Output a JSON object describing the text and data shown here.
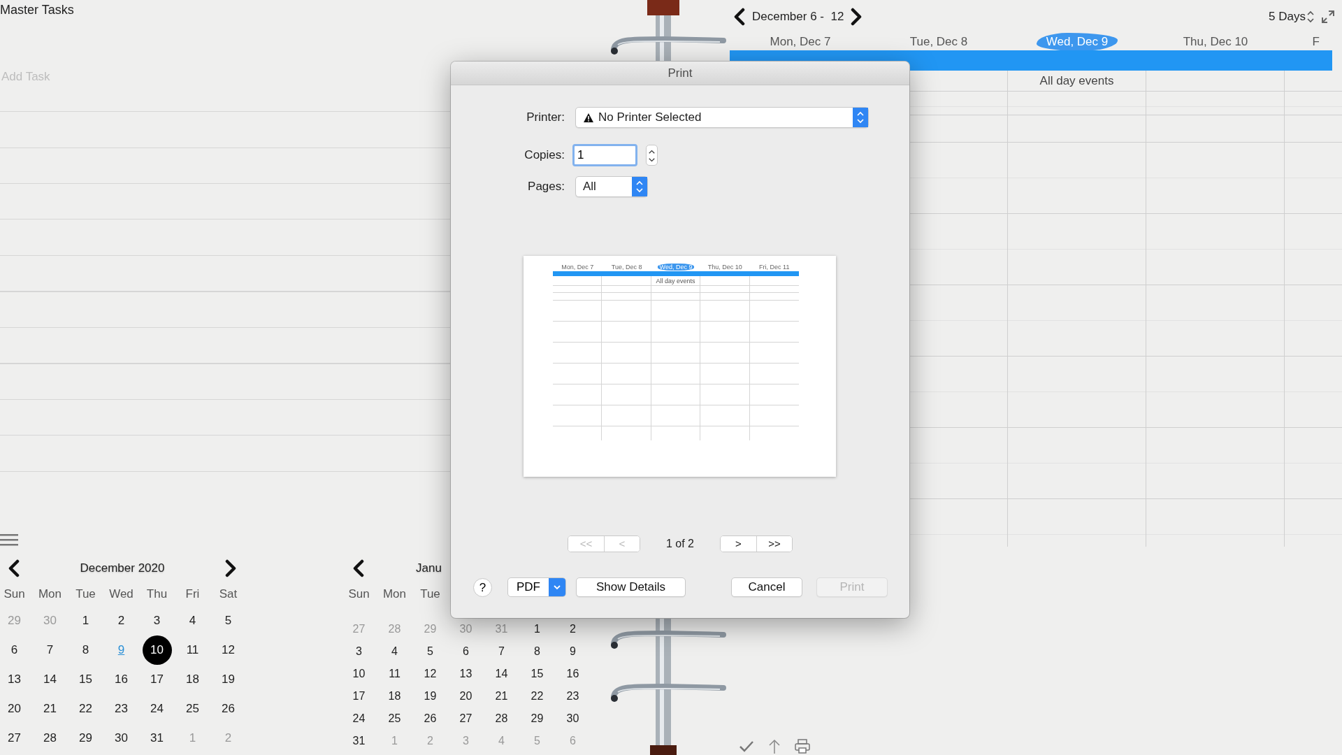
{
  "tasks_page": {
    "title": "Master Tasks",
    "add_task": {
      "placeholder": "Add Task"
    }
  },
  "mini_calendars": [
    {
      "title": "December 2020",
      "next_arrow": true,
      "weekdays": [
        "Sun",
        "Mon",
        "Tue",
        "Wed",
        "Thu",
        "Fri",
        "Sat"
      ],
      "days": [
        {
          "label": "29",
          "outside": true,
          "selected": false,
          "highlighted": false
        },
        {
          "label": "30",
          "outside": true,
          "selected": false,
          "highlighted": false
        },
        {
          "label": "1",
          "outside": false,
          "selected": false,
          "highlighted": false
        },
        {
          "label": "2",
          "outside": false,
          "selected": false,
          "highlighted": false
        },
        {
          "label": "3",
          "outside": false,
          "selected": false,
          "highlighted": false
        },
        {
          "label": "4",
          "outside": false,
          "selected": false,
          "highlighted": false
        },
        {
          "label": "5",
          "outside": false,
          "selected": false,
          "highlighted": false
        },
        {
          "label": "6",
          "outside": false,
          "selected": false,
          "highlighted": false
        },
        {
          "label": "7",
          "outside": false,
          "selected": false,
          "highlighted": false
        },
        {
          "label": "8",
          "outside": false,
          "selected": false,
          "highlighted": false
        },
        {
          "label": "9",
          "outside": false,
          "selected": false,
          "highlighted": true
        },
        {
          "label": "10",
          "outside": false,
          "selected": true,
          "highlighted": false
        },
        {
          "label": "11",
          "outside": false,
          "selected": false,
          "highlighted": false
        },
        {
          "label": "12",
          "outside": false,
          "selected": false,
          "highlighted": false
        },
        {
          "label": "13",
          "outside": false,
          "selected": false,
          "highlighted": false
        },
        {
          "label": "14",
          "outside": false,
          "selected": false,
          "highlighted": false
        },
        {
          "label": "15",
          "outside": false,
          "selected": false,
          "highlighted": false
        },
        {
          "label": "16",
          "outside": false,
          "selected": false,
          "highlighted": false
        },
        {
          "label": "17",
          "outside": false,
          "selected": false,
          "highlighted": false
        },
        {
          "label": "18",
          "outside": false,
          "selected": false,
          "highlighted": false
        },
        {
          "label": "19",
          "outside": false,
          "selected": false,
          "highlighted": false
        },
        {
          "label": "20",
          "outside": false,
          "selected": false,
          "highlighted": false
        },
        {
          "label": "21",
          "outside": false,
          "selected": false,
          "highlighted": false
        },
        {
          "label": "22",
          "outside": false,
          "selected": false,
          "highlighted": false
        },
        {
          "label": "23",
          "outside": false,
          "selected": false,
          "highlighted": false
        },
        {
          "label": "24",
          "outside": false,
          "selected": false,
          "highlighted": false
        },
        {
          "label": "25",
          "outside": false,
          "selected": false,
          "highlighted": false
        },
        {
          "label": "26",
          "outside": false,
          "selected": false,
          "highlighted": false
        },
        {
          "label": "27",
          "outside": false,
          "selected": false,
          "highlighted": false
        },
        {
          "label": "28",
          "outside": false,
          "selected": false,
          "highlighted": false
        },
        {
          "label": "29",
          "outside": false,
          "selected": false,
          "highlighted": false
        },
        {
          "label": "30",
          "outside": false,
          "selected": false,
          "highlighted": false
        },
        {
          "label": "31",
          "outside": false,
          "selected": false,
          "highlighted": false
        },
        {
          "label": "1",
          "outside": true,
          "selected": false,
          "highlighted": false
        },
        {
          "label": "2",
          "outside": true,
          "selected": false,
          "highlighted": false
        }
      ]
    },
    {
      "title": "Janu",
      "next_arrow": false,
      "weekdays": [
        "Sun",
        "Mon",
        "Tue"
      ],
      "days": [
        {
          "label": "27",
          "outside": true,
          "selected": false
        },
        {
          "label": "28",
          "outside": true,
          "selected": false
        },
        {
          "label": "29",
          "outside": true,
          "selected": false
        },
        {
          "label": "30",
          "outside": true,
          "selected": false
        },
        {
          "label": "31",
          "outside": true,
          "selected": false
        },
        {
          "label": "1",
          "outside": false,
          "selected": false
        },
        {
          "label": "2",
          "outside": false,
          "selected": false
        },
        {
          "label": "3",
          "outside": false,
          "selected": false
        },
        {
          "label": "4",
          "outside": false,
          "selected": false
        },
        {
          "label": "5",
          "outside": false,
          "selected": false
        },
        {
          "label": "6",
          "outside": false,
          "selected": false
        },
        {
          "label": "7",
          "outside": false,
          "selected": false
        },
        {
          "label": "8",
          "outside": false,
          "selected": false
        },
        {
          "label": "9",
          "outside": false,
          "selected": false
        },
        {
          "label": "10",
          "outside": false,
          "selected": false
        },
        {
          "label": "11",
          "outside": false,
          "selected": false
        },
        {
          "label": "12",
          "outside": false,
          "selected": false
        },
        {
          "label": "13",
          "outside": false,
          "selected": false
        },
        {
          "label": "14",
          "outside": false,
          "selected": false
        },
        {
          "label": "15",
          "outside": false,
          "selected": false
        },
        {
          "label": "16",
          "outside": false,
          "selected": false
        },
        {
          "label": "17",
          "outside": false,
          "selected": false
        },
        {
          "label": "18",
          "outside": false,
          "selected": false
        },
        {
          "label": "19",
          "outside": false,
          "selected": false
        },
        {
          "label": "20",
          "outside": false,
          "selected": false
        },
        {
          "label": "21",
          "outside": false,
          "selected": false
        },
        {
          "label": "22",
          "outside": false,
          "selected": false
        },
        {
          "label": "23",
          "outside": false,
          "selected": false
        },
        {
          "label": "24",
          "outside": false,
          "selected": false
        },
        {
          "label": "25",
          "outside": false,
          "selected": false
        },
        {
          "label": "26",
          "outside": false,
          "selected": false
        },
        {
          "label": "27",
          "outside": false,
          "selected": false
        },
        {
          "label": "28",
          "outside": false,
          "selected": false
        },
        {
          "label": "29",
          "outside": false,
          "selected": false
        },
        {
          "label": "30",
          "outside": false,
          "selected": false
        },
        {
          "label": "31",
          "outside": false,
          "selected": false
        },
        {
          "label": "1",
          "outside": true,
          "selected": false
        },
        {
          "label": "2",
          "outside": true,
          "selected": false
        },
        {
          "label": "3",
          "outside": true,
          "selected": false
        },
        {
          "label": "4",
          "outside": true,
          "selected": false
        },
        {
          "label": "5",
          "outside": true,
          "selected": false
        },
        {
          "label": "6",
          "outside": true,
          "selected": false
        }
      ]
    }
  ],
  "week_view": {
    "range": "December 6 -  12",
    "view_mode": "5 Days",
    "all_day_label": "All day events",
    "days": [
      {
        "label": "Mon, Dec 7",
        "selected": false
      },
      {
        "label": "Tue, Dec 8",
        "selected": false
      },
      {
        "label": "Wed, Dec 9",
        "selected": true
      },
      {
        "label": "Thu, Dec 10",
        "selected": false
      },
      {
        "label": "F",
        "selected": false
      }
    ]
  },
  "print_dialog": {
    "title": "Print",
    "printer": {
      "label": "Printer:",
      "value": "No Printer Selected"
    },
    "copies": {
      "label": "Copies:",
      "value": "1"
    },
    "pages": {
      "label": "Pages:",
      "value": "All"
    },
    "preview": {
      "all_day_label": "All day events",
      "days": [
        {
          "label": "Mon, Dec 7",
          "selected": false
        },
        {
          "label": "Tue, Dec 8",
          "selected": false
        },
        {
          "label": "Wed, Dec 9",
          "selected": true
        },
        {
          "label": "Thu, Dec 10",
          "selected": false
        },
        {
          "label": "Fri, Dec 11",
          "selected": false
        }
      ]
    },
    "page_nav": [
      {
        "label": "<<",
        "disabled": true
      },
      {
        "label": "<",
        "disabled": true
      },
      {
        "label": ">",
        "disabled": false
      },
      {
        "label": ">>",
        "disabled": false
      }
    ],
    "page_indicator": "1 of 2",
    "help": "?",
    "pdf": "PDF",
    "buttons": [
      {
        "label": "Show Details",
        "disabled": false
      },
      {
        "label": "Cancel",
        "disabled": false
      },
      {
        "label": "Print",
        "disabled": true
      }
    ]
  }
}
